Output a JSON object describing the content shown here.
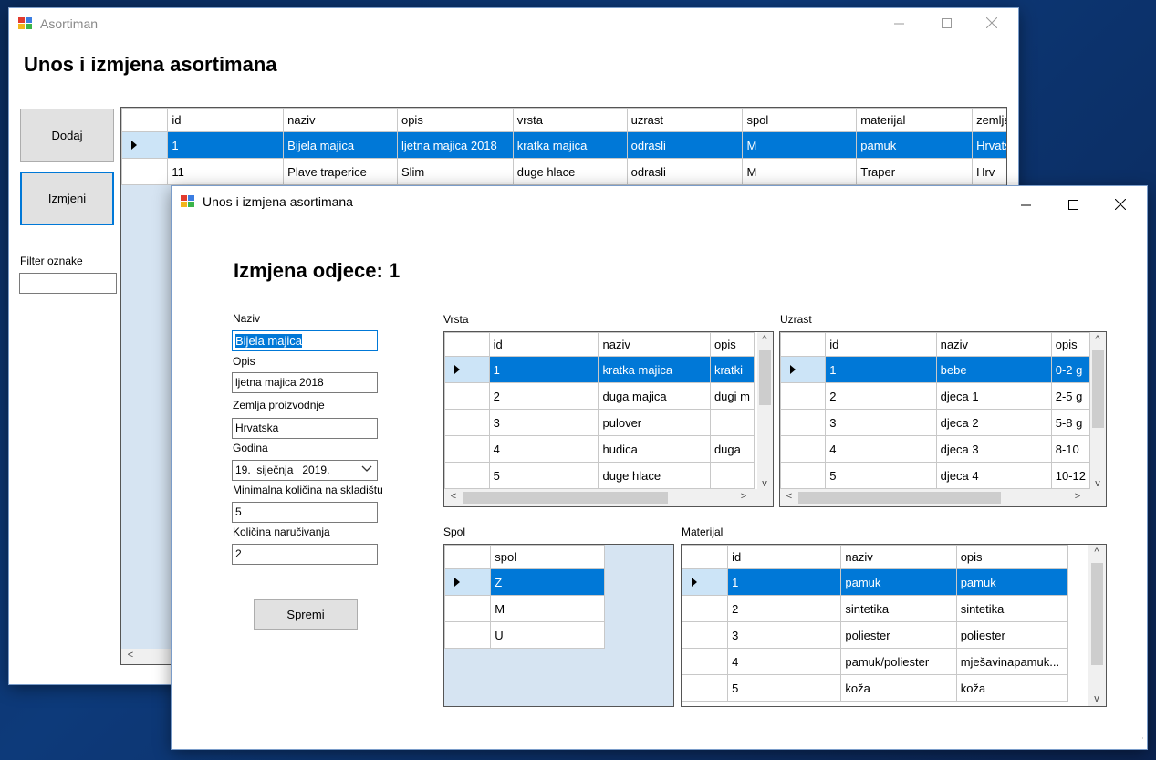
{
  "main": {
    "title": "Asortiman",
    "heading": "Unos i izmjena asortimana",
    "add_label": "Dodaj",
    "edit_label": "Izmjeni",
    "filter_label": "Filter oznake",
    "filter_value": "",
    "columns": [
      "id",
      "naziv",
      "opis",
      "vrsta",
      "uzrast",
      "spol",
      "materijal",
      "zemlja"
    ],
    "rows": [
      [
        "1",
        "Bijela majica",
        "ljetna majica 2018",
        "kratka majica",
        "odrasli",
        "M",
        "pamuk",
        "Hrvats"
      ],
      [
        "11",
        "Plave traperice",
        "Slim",
        "duge hlace",
        "odrasli",
        "M",
        "Traper",
        "Hrv"
      ]
    ]
  },
  "dialog": {
    "title": "Unos i izmjena asortimana",
    "heading": "Izmjena odjece: 1",
    "naziv_label": "Naziv",
    "naziv_value": "Bijela majica",
    "opis_label": "Opis",
    "opis_value": "ljetna majica 2018",
    "zemlja_label": "Zemlja proizvodnje",
    "zemlja_value": "Hrvatska",
    "godina_label": "Godina",
    "godina_value": "19.  siječnja   2019.",
    "min_label": "Minimalna količina na skladištu",
    "min_value": "5",
    "narucivanje_label": "Količina naručivanja",
    "narucivanje_value": "2",
    "save_label": "Spremi",
    "vrsta": {
      "label": "Vrsta",
      "columns": [
        "id",
        "naziv",
        "opis"
      ],
      "rows": [
        [
          "1",
          "kratka majica",
          "kratki"
        ],
        [
          "2",
          "duga majica",
          "dugi m"
        ],
        [
          "3",
          "pulover",
          ""
        ],
        [
          "4",
          "hudica",
          "duga"
        ],
        [
          "5",
          "duge hlace",
          ""
        ]
      ]
    },
    "uzrast": {
      "label": "Uzrast",
      "columns": [
        "id",
        "naziv",
        "opis"
      ],
      "rows": [
        [
          "1",
          "bebe",
          "0-2 g"
        ],
        [
          "2",
          "djeca 1",
          "2-5 g"
        ],
        [
          "3",
          "djeca 2",
          "5-8 g"
        ],
        [
          "4",
          "djeca 3",
          "8-10"
        ],
        [
          "5",
          "djeca 4",
          "10-12"
        ]
      ]
    },
    "spol": {
      "label": "Spol",
      "columns": [
        "spol"
      ],
      "rows": [
        [
          "Z"
        ],
        [
          "M"
        ],
        [
          "U"
        ]
      ]
    },
    "materijal": {
      "label": "Materijal",
      "columns": [
        "id",
        "naziv",
        "opis"
      ],
      "rows": [
        [
          "1",
          "pamuk",
          "pamuk"
        ],
        [
          "2",
          "sintetika",
          "sintetika"
        ],
        [
          "3",
          "poliester",
          "poliester"
        ],
        [
          "4",
          "pamuk/poliester",
          "mješavinapamuk..."
        ],
        [
          "5",
          "koža",
          "koža"
        ]
      ]
    }
  }
}
